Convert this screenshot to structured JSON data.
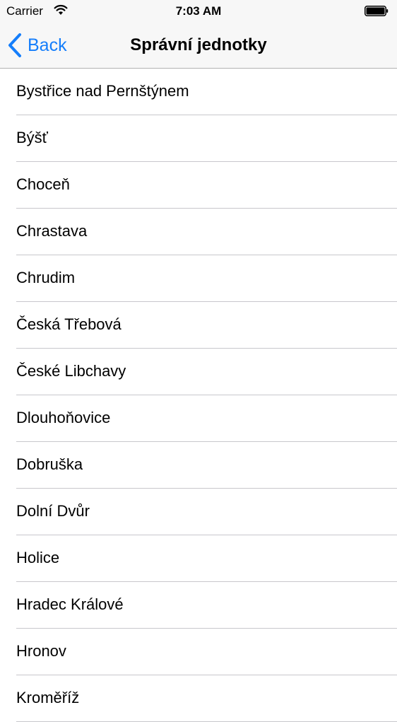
{
  "status_bar": {
    "carrier": "Carrier",
    "time": "7:03 AM",
    "wifi_icon": "wifi-icon",
    "battery_icon": "battery-icon"
  },
  "nav_bar": {
    "back_label": "Back",
    "back_icon": "chevron-left-icon",
    "title": "Správní jednotky",
    "accent_color": "#157efb"
  },
  "list": {
    "items": [
      {
        "label": "Bystřice nad Pernštýnem"
      },
      {
        "label": "Býšť"
      },
      {
        "label": "Choceň"
      },
      {
        "label": "Chrastava"
      },
      {
        "label": "Chrudim"
      },
      {
        "label": "Česká Třebová"
      },
      {
        "label": "České Libchavy"
      },
      {
        "label": "Dlouhoňovice"
      },
      {
        "label": "Dobruška"
      },
      {
        "label": "Dolní Dvůr"
      },
      {
        "label": "Holice"
      },
      {
        "label": "Hradec Králové"
      },
      {
        "label": "Hronov"
      },
      {
        "label": "Kroměříž"
      }
    ]
  }
}
